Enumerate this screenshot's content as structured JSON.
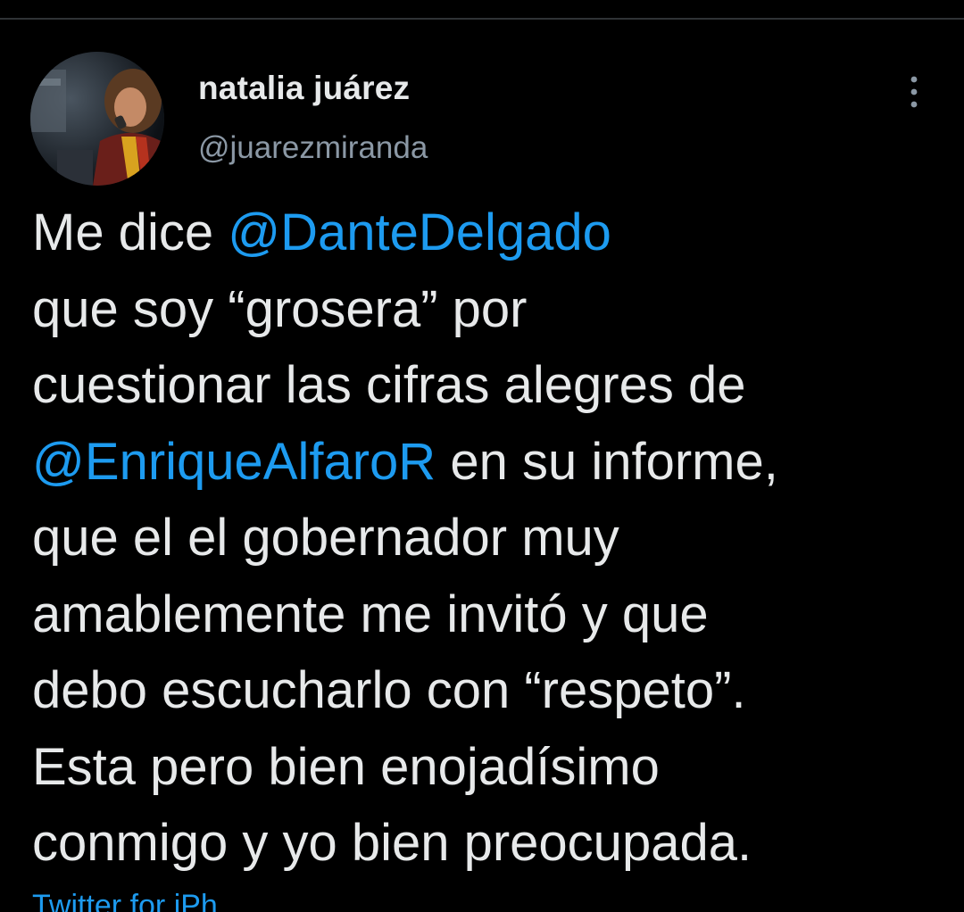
{
  "tweet": {
    "author": {
      "display_name": "natalia juárez",
      "handle": "@juarezmiranda",
      "avatar_icon": "profile-photo"
    },
    "more_icon": "vertical-ellipsis-icon",
    "text_lines": [
      {
        "before": "Me dice ",
        "mention": "@DanteDelgado",
        "after": ""
      },
      {
        "before": "que soy “grosera” por",
        "mention": "",
        "after": ""
      },
      {
        "before": "cuestionar las cifras alegres de",
        "mention": "",
        "after": ""
      },
      {
        "before": "",
        "mention": "@EnriqueAlfaroR",
        "after": " en su informe,"
      },
      {
        "before": "que el el gobernador muy",
        "mention": "",
        "after": ""
      },
      {
        "before": "amablemente me invitó y que",
        "mention": "",
        "after": ""
      },
      {
        "before": "debo escucharlo con “respeto”.",
        "mention": "",
        "after": ""
      },
      {
        "before": "Esta pero bien enojadísimo",
        "mention": "",
        "after": ""
      },
      {
        "before": "conmigo y yo bien preocupada.",
        "mention": "",
        "after": ""
      }
    ],
    "meta": {
      "source_partial": "Twitter for iPh"
    }
  },
  "colors": {
    "background": "#000000",
    "text": "#e7e9ea",
    "secondary": "#8b98a5",
    "link": "#1d9bf0",
    "divider": "#2f3336"
  }
}
